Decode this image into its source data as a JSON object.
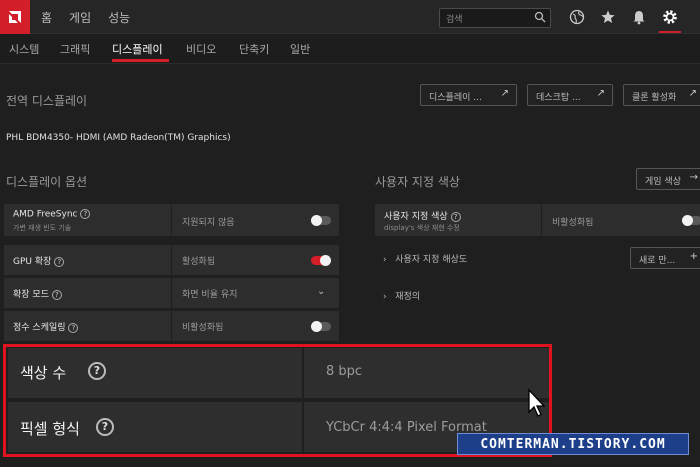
{
  "topnav": {
    "home": "홈",
    "gaming": "게임",
    "performance": "성능"
  },
  "search": {
    "placeholder": "검색"
  },
  "subnav": [
    "시스템",
    "그래픽",
    "디스플레이",
    "비디오",
    "단축키",
    "일반"
  ],
  "global_display": {
    "title": "전역 디스플레이",
    "buttons": [
      "디스플레이 ...",
      "데스크탑 ...",
      "클론 활성화"
    ]
  },
  "monitor_name": "PHL BDM4350- HDMI (AMD Radeon(TM) Graphics)",
  "display_options": {
    "title": "디스플레이 옵션",
    "freesync": {
      "label": "AMD FreeSync",
      "sub": "가변 재생 빈도 기술",
      "value": "지원되지 않음",
      "toggle": "off"
    },
    "gpu_scaling": {
      "label": "GPU 확장",
      "value": "활성화됨",
      "toggle": "on"
    },
    "scaling_mode": {
      "label": "확장 모드",
      "value": "화면 비율 유지"
    },
    "integer_scaling": {
      "label": "정수 스케일링",
      "value": "비활성화됨",
      "toggle": "off"
    }
  },
  "custom_color": {
    "title": "사용자 지정 색상",
    "game_color_button": "게임 색상",
    "row": {
      "label": "사용자 지정 색상",
      "sub": "display's 색상 재현 수정",
      "value": "비활성화됨",
      "toggle": "off"
    },
    "custom_resolution": "사용자 지정 해상도",
    "new_button": "새로 만...",
    "override": "재정의"
  },
  "highlight": {
    "color_depth": {
      "label": "색상 수",
      "value": "8 bpc"
    },
    "pixel_format": {
      "label": "픽셀 형식",
      "value": "YCbCr 4:4:4 Pixel Format"
    }
  },
  "watermark": "COMTERMAN.TISTORY.COM",
  "colors": {
    "accent": "#d41e2a",
    "highlight_border": "#e0141e"
  }
}
